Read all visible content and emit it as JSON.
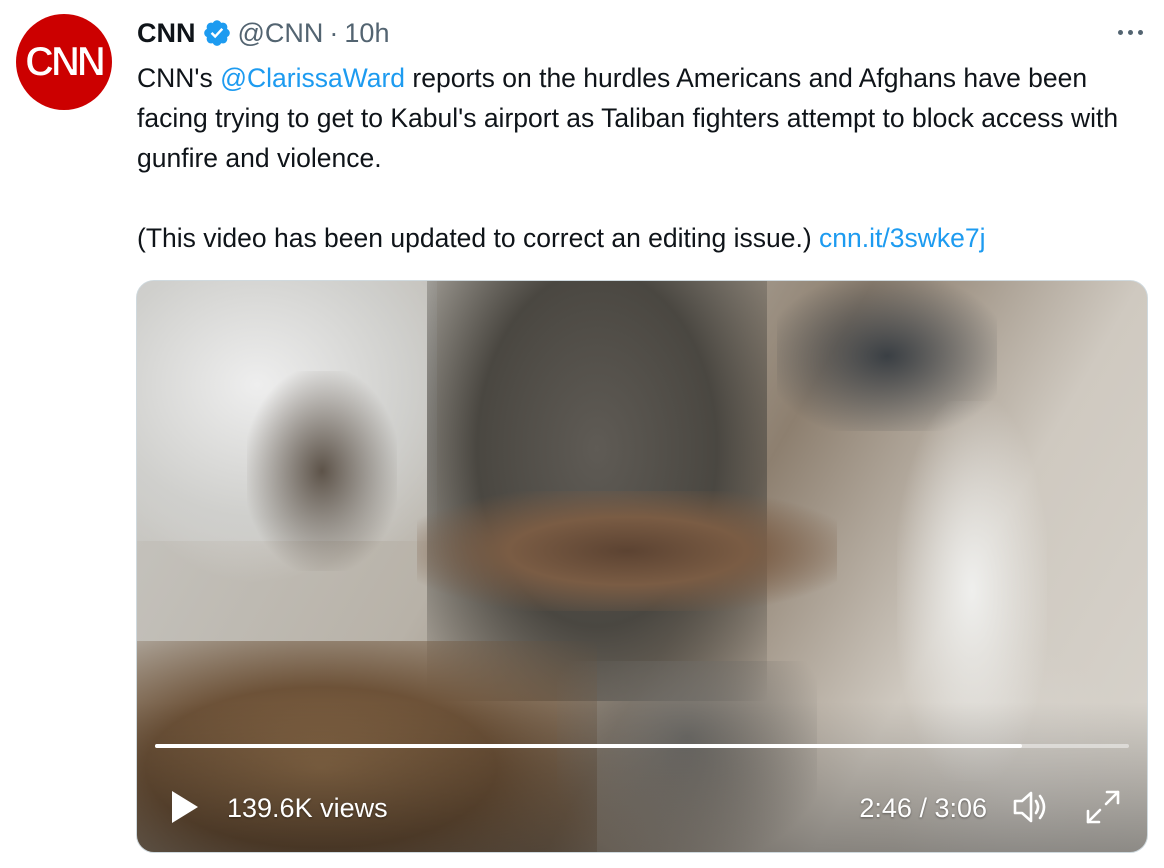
{
  "author": {
    "name": "CNN",
    "handle": "@CNN",
    "separator": "·",
    "time": "10h",
    "avatar_logo": "CNN",
    "verified_icon": "verified-badge-icon",
    "colors": {
      "avatar": "#cc0000",
      "verified": "#1d9bf0"
    }
  },
  "tweet": {
    "text_pre": "CNN's ",
    "mention": "@ClarissaWard",
    "text_post": " reports on the hurdles Americans and Afghans have been facing trying to get to Kabul's airport as Taliban fighters attempt to block access with gunfire and violence.",
    "text_note": "(This video has been updated to correct an editing issue.) ",
    "short_link": "cnn.it/3swke7j",
    "link_color": "#1d9bf0"
  },
  "video": {
    "views": "139.6K views",
    "time_readout": "2:46 / 3:06",
    "progress": 0.89,
    "icons": {
      "play": "play-icon",
      "volume": "volume-icon",
      "fullscreen": "fullscreen-icon",
      "more": "more-options-icon"
    }
  }
}
